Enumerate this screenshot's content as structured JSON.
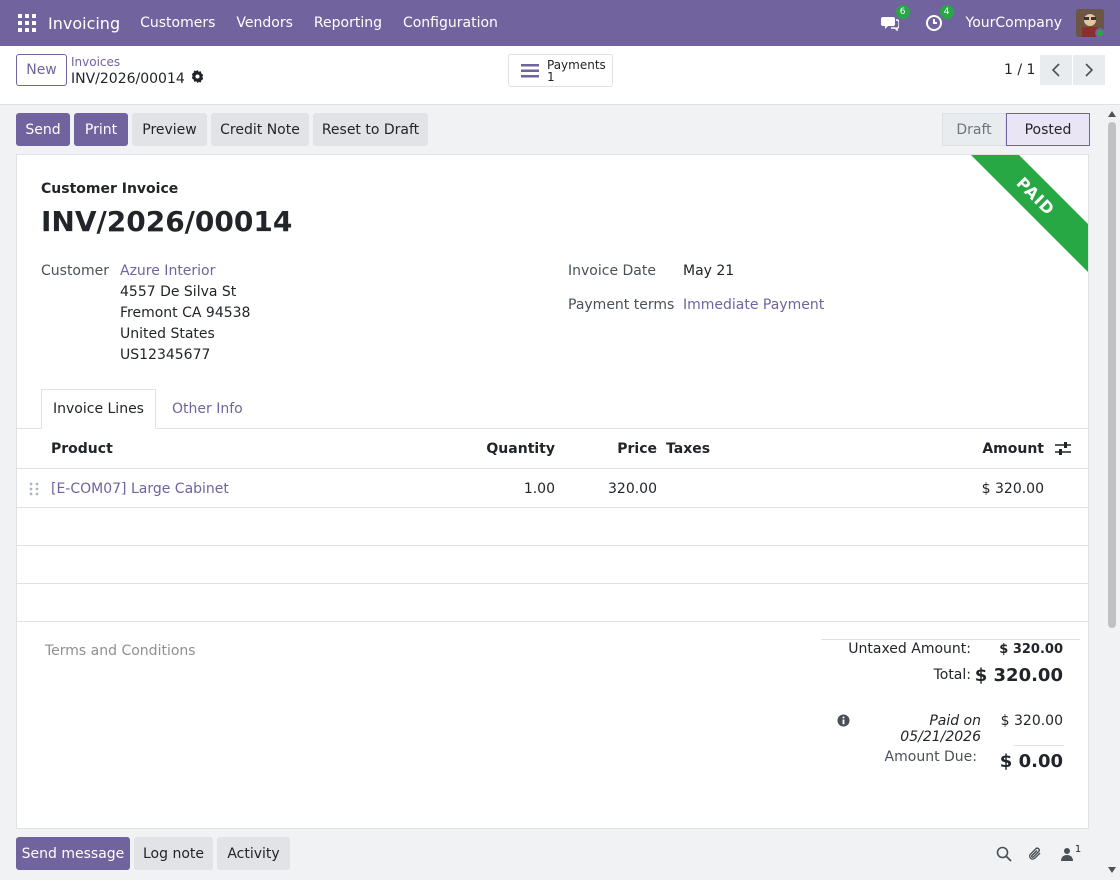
{
  "navbar": {
    "app_name": "Invoicing",
    "menu": [
      "Customers",
      "Vendors",
      "Reporting",
      "Configuration"
    ],
    "messages_badge": "6",
    "activities_badge": "4",
    "company": "YourCompany"
  },
  "control": {
    "new_label": "New",
    "breadcrumb": "Invoices",
    "record_name": "INV/2026/00014",
    "smart_button": {
      "label": "Payments",
      "count": "1"
    },
    "pager": "1 / 1"
  },
  "actions": {
    "send": "Send",
    "print": "Print",
    "preview": "Preview",
    "credit_note": "Credit Note",
    "reset": "Reset to Draft"
  },
  "status": {
    "draft": "Draft",
    "posted": "Posted"
  },
  "sheet": {
    "ribbon": "PAID",
    "type_label": "Customer Invoice",
    "title": "INV/2026/00014",
    "customer_label": "Customer",
    "customer_name": "Azure Interior",
    "address": [
      "4557 De Silva St",
      "Fremont CA 94538",
      "United States",
      "US12345677"
    ],
    "invoice_date_label": "Invoice Date",
    "invoice_date": "May 21",
    "payment_terms_label": "Payment terms",
    "payment_terms": "Immediate Payment"
  },
  "tabs": {
    "lines": "Invoice Lines",
    "other": "Other Info"
  },
  "lines": {
    "headers": {
      "product": "Product",
      "quantity": "Quantity",
      "price": "Price",
      "taxes": "Taxes",
      "amount": "Amount"
    },
    "rows": [
      {
        "product": "[E-COM07] Large Cabinet",
        "quantity": "1.00",
        "price": "320.00",
        "taxes": "",
        "amount": "$ 320.00"
      }
    ]
  },
  "totals": {
    "terms_placeholder": "Terms and Conditions",
    "untaxed_label": "Untaxed Amount:",
    "untaxed_value": "$ 320.00",
    "total_label": "Total:",
    "total_value": "$ 320.00",
    "paid_label": "Paid on 05/21/2026",
    "paid_value": "$ 320.00",
    "due_label": "Amount Due:",
    "due_value": "$ 0.00"
  },
  "chatter": {
    "send_message": "Send message",
    "log_note": "Log note",
    "activity": "Activity",
    "followers_count": "1"
  },
  "colors": {
    "brand": "#71639e",
    "paid": "#28a745"
  }
}
